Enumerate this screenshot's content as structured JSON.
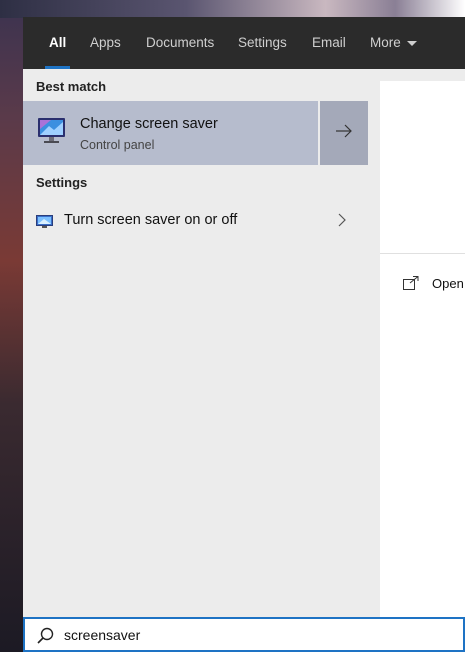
{
  "tabs": [
    {
      "label": "All",
      "active": true
    },
    {
      "label": "Apps"
    },
    {
      "label": "Documents"
    },
    {
      "label": "Settings"
    },
    {
      "label": "Email"
    },
    {
      "label": "More"
    }
  ],
  "best_match": {
    "header": "Best match",
    "title": "Change screen saver",
    "subtitle": "Control panel",
    "icon": "monitor-screensaver-icon"
  },
  "settings": {
    "header": "Settings",
    "items": [
      {
        "label": "Turn screen saver on or off",
        "icon": "screensaver-settings-icon"
      }
    ]
  },
  "detail": {
    "open_label": "Open"
  },
  "search": {
    "value": "screensaver"
  },
  "colors": {
    "accent": "#1e73c4",
    "tabbar": "#2b2b2b",
    "selected": "#b6bccd",
    "panel": "#ececec"
  }
}
